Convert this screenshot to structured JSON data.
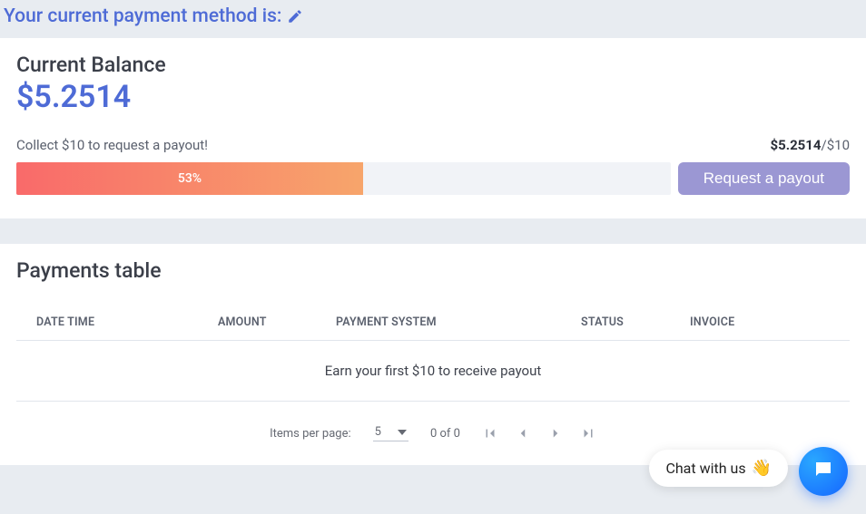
{
  "header": {
    "payment_method_label": "Your current payment method is:"
  },
  "balance": {
    "title": "Current Balance",
    "amount": "$5.2514",
    "collect_hint": "Collect $10 to request a payout!",
    "current_value": "$5.2514",
    "target_value": "/$10",
    "progress_label": "53%",
    "progress_percent": 53,
    "payout_button": "Request a payout"
  },
  "payments": {
    "title": "Payments table",
    "columns": {
      "date_time": "DATE TIME",
      "amount": "AMOUNT",
      "system": "PAYMENT SYSTEM",
      "status": "STATUS",
      "invoice": "INVOICE"
    },
    "empty_message": "Earn your first $10 to receive payout"
  },
  "paginator": {
    "items_label": "Items per page:",
    "page_size": "5",
    "range": "0 of 0"
  },
  "chat": {
    "pill_text": "Chat with us"
  }
}
